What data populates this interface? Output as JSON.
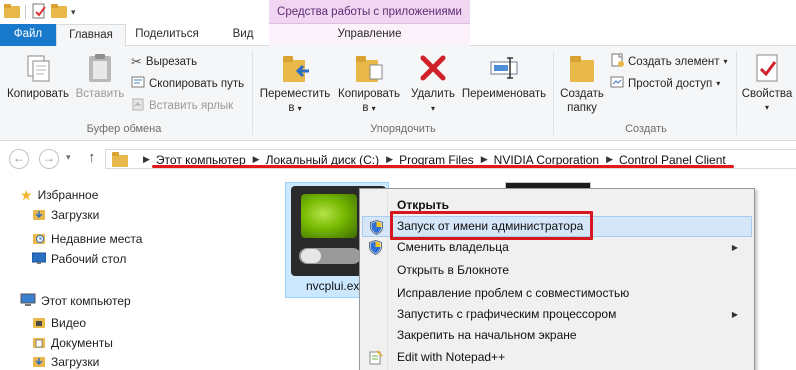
{
  "window": {
    "context_tab_title": "Средства работы с приложениями"
  },
  "tabs": {
    "file": "Файл",
    "home": "Главная",
    "share": "Поделиться",
    "view": "Вид",
    "manage": "Управление"
  },
  "ribbon": {
    "clipboard": {
      "group_label": "Буфер обмена",
      "copy": "Копировать",
      "paste": "Вставить",
      "cut": "Вырезать",
      "copy_path": "Скопировать путь",
      "paste_shortcut": "Вставить ярлык"
    },
    "organize": {
      "group_label": "Упорядочить",
      "move_to_line1": "Переместить",
      "move_to_line2": "в",
      "copy_to_line1": "Копировать",
      "copy_to_line2": "в",
      "delete": "Удалить",
      "rename": "Переименовать"
    },
    "new": {
      "group_label": "Создать",
      "new_folder_line1": "Создать",
      "new_folder_line2": "папку",
      "new_item": "Создать элемент",
      "easy_access": "Простой доступ"
    },
    "open": {
      "properties": "Свойства"
    }
  },
  "address_bar": {
    "breadcrumbs": [
      "Этот компьютер",
      "Локальный диск (C:)",
      "Program Files",
      "NVIDIA Corporation",
      "Control Panel Client"
    ]
  },
  "nav_pane": {
    "favorites": {
      "label": "Избранное",
      "items": [
        "Загрузки",
        "Недавние места",
        "Рабочий стол"
      ]
    },
    "this_pc": {
      "label": "Этот компьютер",
      "items": [
        "Видео",
        "Документы",
        "Загрузки"
      ]
    }
  },
  "content": {
    "selected_file": "nvcplui.exe"
  },
  "context_menu": {
    "items": [
      {
        "label": "Открыть"
      },
      {
        "label": "Запуск от имени администратора"
      },
      {
        "label": "Сменить владельца"
      },
      {
        "label": "Открыть в Блокноте"
      },
      {
        "label": "Исправление проблем с совместимостью"
      },
      {
        "label": "Запустить с графическим процессором"
      },
      {
        "label": "Закрепить на начальном экране"
      },
      {
        "label": "Edit with Notepad++"
      }
    ]
  },
  "colors": {
    "file_tab": "#1979ca",
    "context_tab": "#f1d6f2",
    "highlight_annotation": "#d6181e",
    "nvidia_green": "#76b900"
  }
}
